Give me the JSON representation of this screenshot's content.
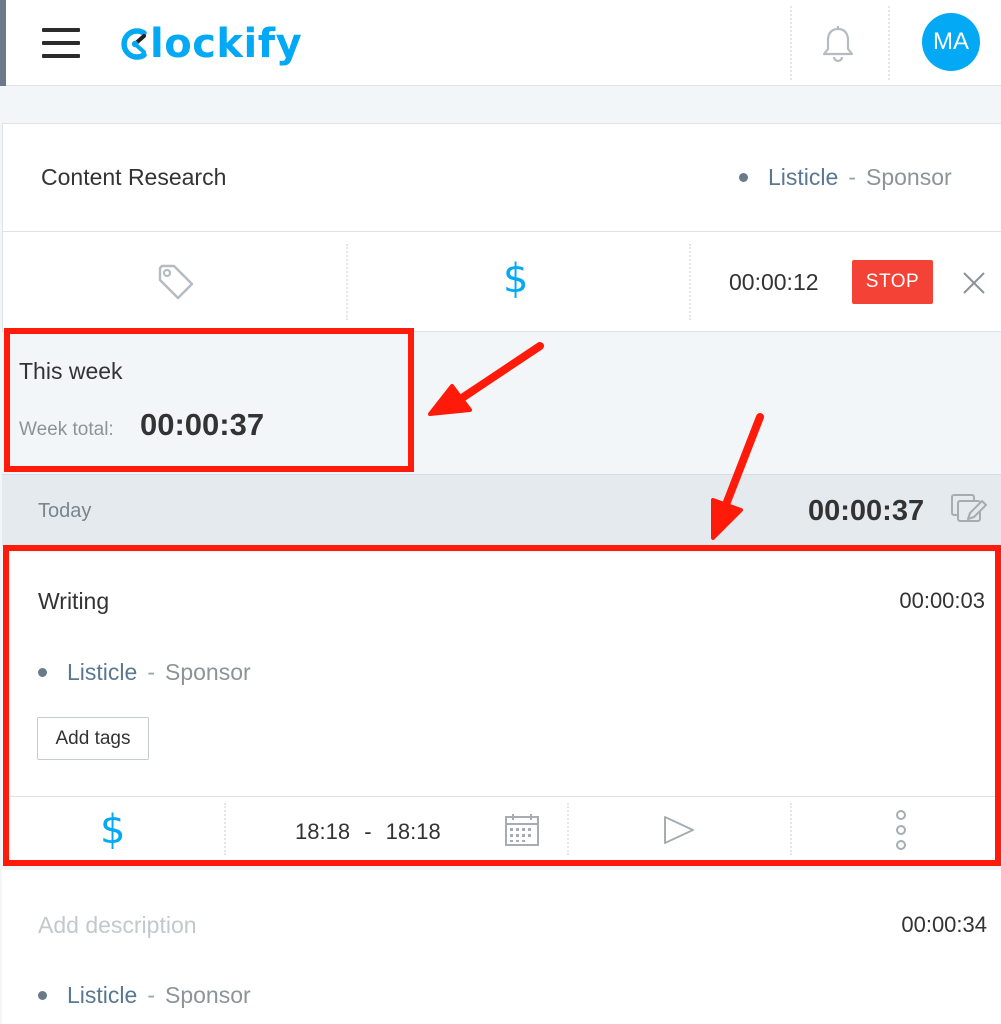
{
  "header": {
    "logo_text": "lockify",
    "logo_initial_icon": "clockify-logo-icon",
    "notification_icon": "bell-icon",
    "avatar_initials": "MA",
    "menu_icon": "hamburger-icon"
  },
  "timer": {
    "description": "Content Research",
    "project": "Listicle",
    "separator": "-",
    "client": "Sponsor",
    "tag_icon": "tag-icon",
    "billable_symbol": "$",
    "elapsed": "00:00:12",
    "stop_label": "STOP",
    "discard_icon": "close-icon"
  },
  "week": {
    "title": "This week",
    "total_label": "Week total:",
    "total_value": "00:00:37"
  },
  "today": {
    "label": "Today",
    "total": "00:00:37",
    "bulk_edit_icon": "bulk-edit-icon"
  },
  "entries": [
    {
      "description": "Writing",
      "duration": "00:00:03",
      "project": "Listicle",
      "separator": "-",
      "client": "Sponsor",
      "add_tags_label": "Add tags",
      "billable_symbol": "$",
      "start": "18:18",
      "range_sep": "-",
      "end": "18:18"
    },
    {
      "description_placeholder": "Add description",
      "duration": "00:00:34",
      "project": "Listicle",
      "separator": "-",
      "client": "Sponsor"
    }
  ],
  "colors": {
    "accent": "#03a9f4",
    "stop": "#f44336",
    "annotation": "#ff1a0a"
  }
}
